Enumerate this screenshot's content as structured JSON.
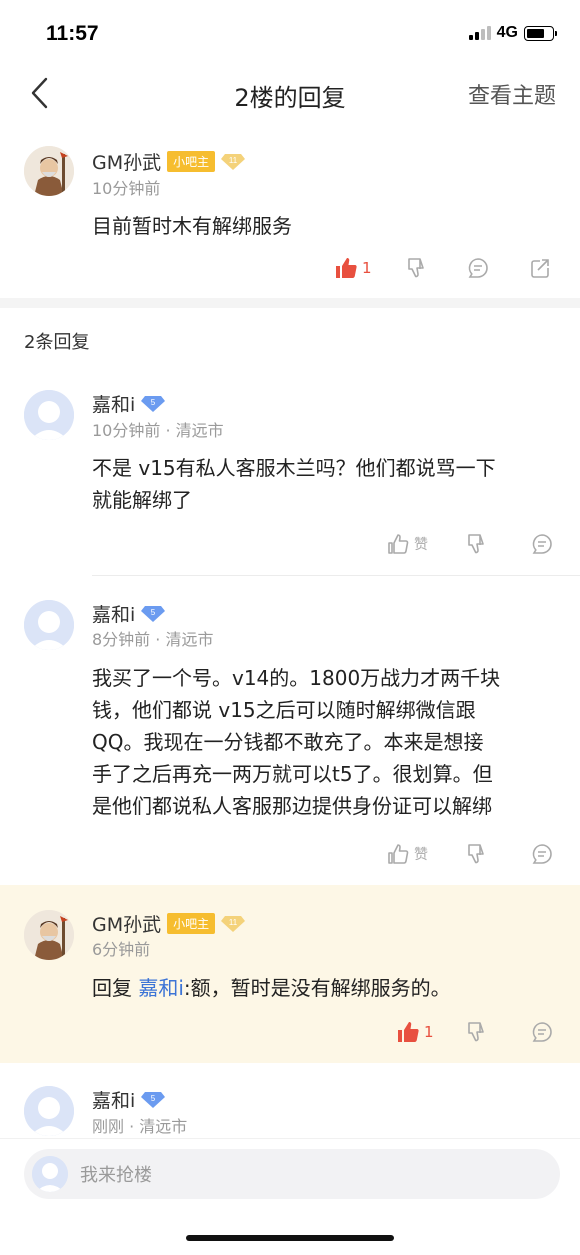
{
  "status": {
    "time": "11:57",
    "network": "4G"
  },
  "nav": {
    "title": "2楼的回复",
    "action": "查看主题"
  },
  "main_post": {
    "username": "GM孙武",
    "badge": "小吧主",
    "level": "11",
    "time": "10分钟前",
    "text": "目前暂时木有解绑服务",
    "likes": "1"
  },
  "reply_count_label": "2条回复",
  "replies": [
    {
      "username": "嘉和i",
      "level": "5",
      "meta": "10分钟前 · 清远市",
      "lines": [
        "不是 v15有私人客服木兰吗？他们都说骂一下",
        "就能解绑了"
      ],
      "like_label": "赞"
    },
    {
      "username": "嘉和i",
      "level": "5",
      "meta": "8分钟前 · 清远市",
      "lines": [
        "我买了一个号。v14的。1800万战力才两千块",
        "钱，他们都说 v15之后可以随时解绑微信跟",
        "QQ。我现在一分钱都不敢充了。本来是想接",
        "手了之后再充一两万就可以t5了。很划算。但",
        "是他们都说私人客服那边提供身份证可以解绑"
      ],
      "like_label": "赞"
    },
    {
      "username": "GM孙武",
      "badge": "小吧主",
      "level": "11",
      "meta": "6分钟前",
      "reply_prefix": "回复",
      "reply_target": "嘉和i",
      "text": ":额，暂时是没有解绑服务的。",
      "likes": "1"
    },
    {
      "username": "嘉和i",
      "level": "5",
      "meta": "刚刚 · 清远市"
    }
  ],
  "bottom": {
    "placeholder": "我来抢楼"
  },
  "colors": {
    "like_red": "#e8503f",
    "link_blue": "#3d74d6",
    "badge_gold": "#f6bd2f",
    "level_blue": "#6b9bf0",
    "highlight": "#fdf7e6"
  }
}
